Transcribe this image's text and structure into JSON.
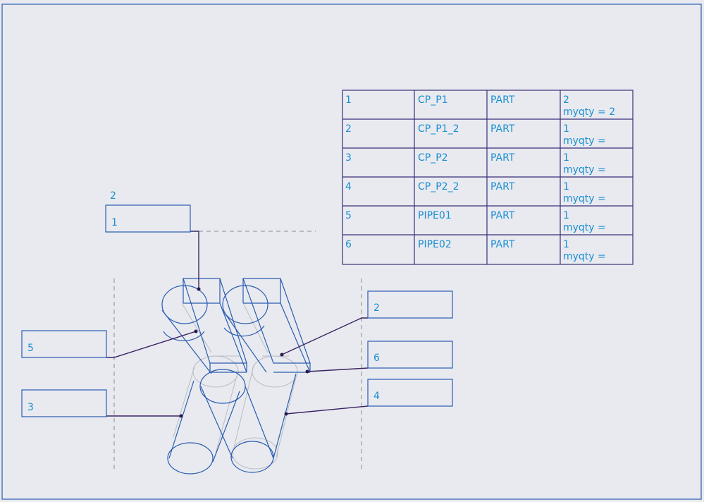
{
  "bom": {
    "rows": [
      {
        "index": "1",
        "name": "CP_P1",
        "type": "PART",
        "qty": "2",
        "param": "myqty = 2"
      },
      {
        "index": "2",
        "name": "CP_P1_2",
        "type": "PART",
        "qty": "1",
        "param": "myqty ="
      },
      {
        "index": "3",
        "name": "CP_P2",
        "type": "PART",
        "qty": "1",
        "param": "myqty ="
      },
      {
        "index": "4",
        "name": "CP_P2_2",
        "type": "PART",
        "qty": "1",
        "param": "myqty ="
      },
      {
        "index": "5",
        "name": "PIPE01",
        "type": "PART",
        "qty": "1",
        "param": "myqty ="
      },
      {
        "index": "6",
        "name": "PIPE02",
        "type": "PART",
        "qty": "1",
        "param": "myqty ="
      }
    ]
  },
  "balloons": [
    {
      "id": "balloon-1",
      "label": "1",
      "qty": "2"
    },
    {
      "id": "balloon-5",
      "label": "5"
    },
    {
      "id": "balloon-3",
      "label": "3"
    },
    {
      "id": "balloon-2",
      "label": "2"
    },
    {
      "id": "balloon-6",
      "label": "6"
    },
    {
      "id": "balloon-4",
      "label": "4"
    }
  ],
  "colors": {
    "background": "#e8eaf0",
    "text": "#1a8fd0",
    "geometry": "#2a5cb0",
    "table_lines": "#3a2f78",
    "hidden_lines": "#b9bcc2"
  }
}
